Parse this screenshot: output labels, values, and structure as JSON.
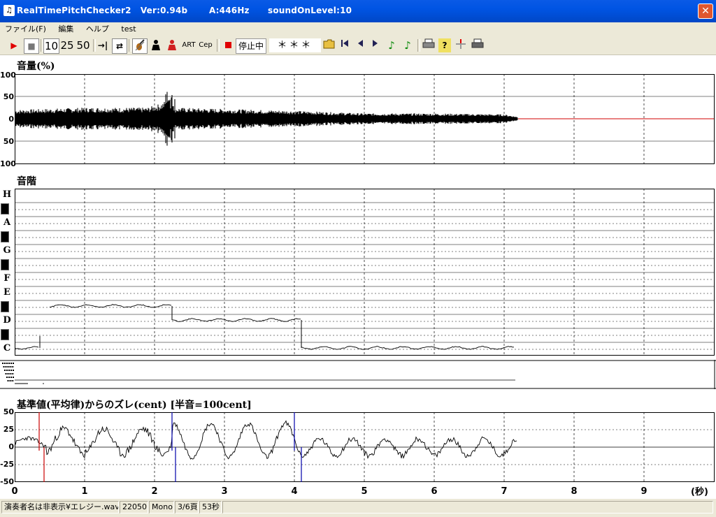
{
  "window": {
    "title": "RealTimePitchChecker2   Ver:0.94b       A:446Hz      soundOnLevel:10",
    "app_icon": "tuning-fork-icon",
    "close_glyph": "✕"
  },
  "menu": [
    "ファイル(F)",
    "編集",
    "ヘルプ",
    "test"
  ],
  "toolbar": {
    "play": "▶",
    "stop": "■",
    "speed_10": "10",
    "speed_25": "25",
    "speed_50": "50",
    "jump": "→|",
    "loop": "⇄",
    "art": "ART",
    "cep": "Cep",
    "status_text": "停止中",
    "pitch_display": "＊＊＊",
    "record_color": "#e00000"
  },
  "volume_panel": {
    "title": "音量(%)",
    "y_ticks": [
      "100",
      "50",
      "0",
      "50",
      "100"
    ]
  },
  "scale_panel": {
    "title": "音階",
    "notes": [
      "H",
      "A",
      "G",
      "F",
      "E",
      "D",
      "C"
    ]
  },
  "deviation_panel": {
    "title": "基準値(平均律)からのズレ(cent) [半音=100cent]",
    "y_ticks": [
      "50",
      "25",
      "0",
      "-25",
      "-50"
    ],
    "x_ticks": [
      "0",
      "1",
      "2",
      "3",
      "4",
      "5",
      "6",
      "7",
      "8",
      "9"
    ],
    "x_unit": "(秒)"
  },
  "chart_data": [
    {
      "type": "area",
      "title": "音量(%)",
      "xlim": [
        0,
        10
      ],
      "ylim": [
        -100,
        100
      ],
      "envelope": {
        "x": [
          0,
          1,
          1.9,
          2.1,
          2.2,
          2.3,
          3,
          4,
          5,
          6,
          7,
          7.2
        ],
        "y": [
          20,
          25,
          25,
          35,
          45,
          25,
          22,
          18,
          12,
          12,
          10,
          4
        ]
      },
      "silent_line_color": "#d00000"
    },
    {
      "type": "line",
      "title": "音階",
      "xlim": [
        0,
        10
      ],
      "segments": [
        {
          "note": "C",
          "x0": 0,
          "x1": 0.35
        },
        {
          "note": "E",
          "x0": 0.5,
          "x1": 2.25
        },
        {
          "note": "D",
          "x0": 2.25,
          "x1": 4.1
        },
        {
          "note": "C",
          "x0": 4.1,
          "x1": 7.15
        }
      ]
    },
    {
      "type": "line",
      "title": "基準値(平均律)からのズレ(cent) [半音=100cent]",
      "xlabel": "(秒)",
      "xlim": [
        0,
        10
      ],
      "ylim": [
        -50,
        50
      ],
      "markers": [
        {
          "x": 0.35,
          "color": "#cc0000"
        },
        {
          "x": 0.42,
          "color": "#cc0000"
        },
        {
          "x": 2.25,
          "color": "#0000aa"
        },
        {
          "x": 2.3,
          "color": "#0000aa"
        },
        {
          "x": 4.0,
          "color": "#0000aa"
        },
        {
          "x": 4.1,
          "color": "#0000aa"
        }
      ]
    }
  ],
  "statusbar": {
    "file": "演奏者名は非表示¥エレジー.wav",
    "rate": "22050",
    "channels": "Mono",
    "page": "3/6頁",
    "duration": "53秒"
  }
}
